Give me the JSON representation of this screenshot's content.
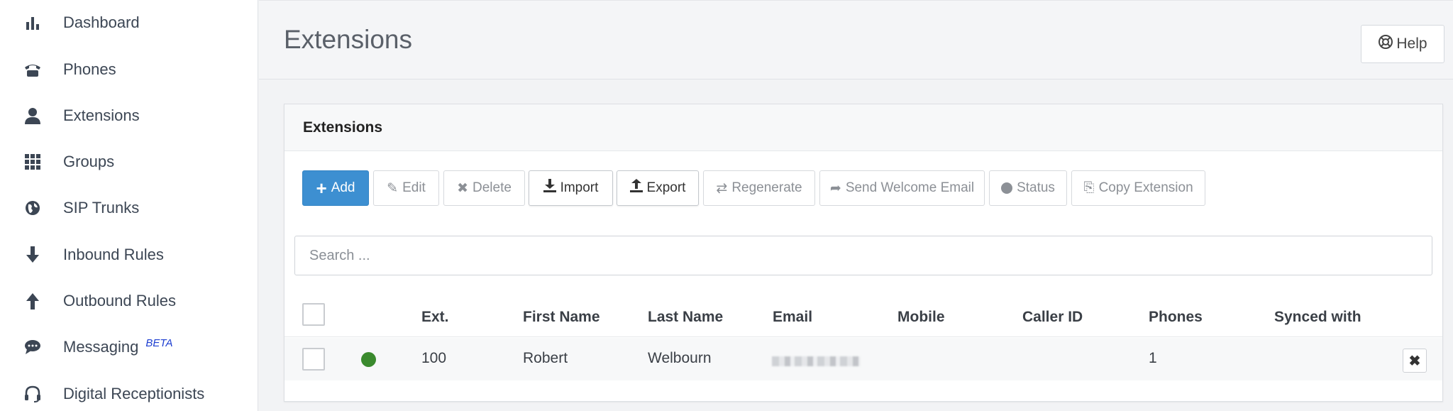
{
  "sidebar": {
    "items": [
      {
        "label": "Dashboard",
        "icon": "bar-chart-icon"
      },
      {
        "label": "Phones",
        "icon": "phone-icon"
      },
      {
        "label": "Extensions",
        "icon": "user-icon"
      },
      {
        "label": "Groups",
        "icon": "grid-icon"
      },
      {
        "label": "SIP Trunks",
        "icon": "globe-icon"
      },
      {
        "label": "Inbound Rules",
        "icon": "arrow-down-icon"
      },
      {
        "label": "Outbound Rules",
        "icon": "arrow-up-icon"
      },
      {
        "label": "Messaging",
        "icon": "chat-icon",
        "badge": "BETA"
      },
      {
        "label": "Digital Receptionists",
        "icon": "headset-icon"
      }
    ]
  },
  "header": {
    "title": "Extensions",
    "help_label": "Help"
  },
  "panel": {
    "title": "Extensions",
    "toolbar": {
      "add": "Add",
      "edit": "Edit",
      "delete": "Delete",
      "import": "Import",
      "export": "Export",
      "regenerate": "Regenerate",
      "send_welcome_email": "Send Welcome Email",
      "status": "Status",
      "copy_extension": "Copy Extension"
    },
    "search_placeholder": "Search ...",
    "table": {
      "columns": [
        "Ext.",
        "First Name",
        "Last Name",
        "Email",
        "Mobile",
        "Caller ID",
        "Phones",
        "Synced with"
      ],
      "rows": [
        {
          "ext": "100",
          "first_name": "Robert",
          "last_name": "Welbourn",
          "email": "",
          "mobile": "",
          "caller_id": "",
          "phones": "1",
          "synced_with": "",
          "status_color": "#3a8a2e"
        }
      ],
      "remove_label": "✖"
    }
  },
  "colors": {
    "primary": "#3d8fd1",
    "status_online": "#3a8a2e",
    "beta": "#1e3fd1"
  }
}
